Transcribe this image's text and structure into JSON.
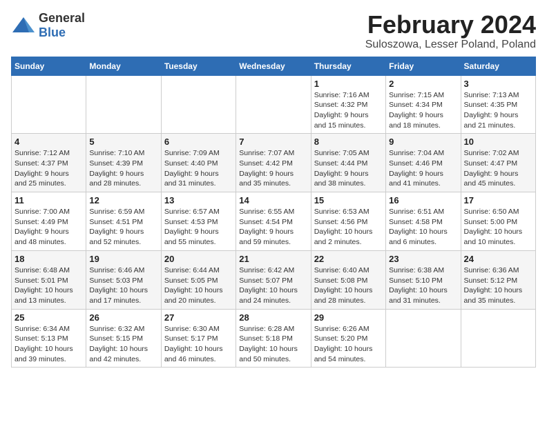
{
  "header": {
    "logo_general": "General",
    "logo_blue": "Blue",
    "month_title": "February 2024",
    "location": "Suloszowa, Lesser Poland, Poland"
  },
  "weekdays": [
    "Sunday",
    "Monday",
    "Tuesday",
    "Wednesday",
    "Thursday",
    "Friday",
    "Saturday"
  ],
  "weeks": [
    [
      {
        "day": "",
        "info": ""
      },
      {
        "day": "",
        "info": ""
      },
      {
        "day": "",
        "info": ""
      },
      {
        "day": "",
        "info": ""
      },
      {
        "day": "1",
        "info": "Sunrise: 7:16 AM\nSunset: 4:32 PM\nDaylight: 9 hours\nand 15 minutes."
      },
      {
        "day": "2",
        "info": "Sunrise: 7:15 AM\nSunset: 4:34 PM\nDaylight: 9 hours\nand 18 minutes."
      },
      {
        "day": "3",
        "info": "Sunrise: 7:13 AM\nSunset: 4:35 PM\nDaylight: 9 hours\nand 21 minutes."
      }
    ],
    [
      {
        "day": "4",
        "info": "Sunrise: 7:12 AM\nSunset: 4:37 PM\nDaylight: 9 hours\nand 25 minutes."
      },
      {
        "day": "5",
        "info": "Sunrise: 7:10 AM\nSunset: 4:39 PM\nDaylight: 9 hours\nand 28 minutes."
      },
      {
        "day": "6",
        "info": "Sunrise: 7:09 AM\nSunset: 4:40 PM\nDaylight: 9 hours\nand 31 minutes."
      },
      {
        "day": "7",
        "info": "Sunrise: 7:07 AM\nSunset: 4:42 PM\nDaylight: 9 hours\nand 35 minutes."
      },
      {
        "day": "8",
        "info": "Sunrise: 7:05 AM\nSunset: 4:44 PM\nDaylight: 9 hours\nand 38 minutes."
      },
      {
        "day": "9",
        "info": "Sunrise: 7:04 AM\nSunset: 4:46 PM\nDaylight: 9 hours\nand 41 minutes."
      },
      {
        "day": "10",
        "info": "Sunrise: 7:02 AM\nSunset: 4:47 PM\nDaylight: 9 hours\nand 45 minutes."
      }
    ],
    [
      {
        "day": "11",
        "info": "Sunrise: 7:00 AM\nSunset: 4:49 PM\nDaylight: 9 hours\nand 48 minutes."
      },
      {
        "day": "12",
        "info": "Sunrise: 6:59 AM\nSunset: 4:51 PM\nDaylight: 9 hours\nand 52 minutes."
      },
      {
        "day": "13",
        "info": "Sunrise: 6:57 AM\nSunset: 4:53 PM\nDaylight: 9 hours\nand 55 minutes."
      },
      {
        "day": "14",
        "info": "Sunrise: 6:55 AM\nSunset: 4:54 PM\nDaylight: 9 hours\nand 59 minutes."
      },
      {
        "day": "15",
        "info": "Sunrise: 6:53 AM\nSunset: 4:56 PM\nDaylight: 10 hours\nand 2 minutes."
      },
      {
        "day": "16",
        "info": "Sunrise: 6:51 AM\nSunset: 4:58 PM\nDaylight: 10 hours\nand 6 minutes."
      },
      {
        "day": "17",
        "info": "Sunrise: 6:50 AM\nSunset: 5:00 PM\nDaylight: 10 hours\nand 10 minutes."
      }
    ],
    [
      {
        "day": "18",
        "info": "Sunrise: 6:48 AM\nSunset: 5:01 PM\nDaylight: 10 hours\nand 13 minutes."
      },
      {
        "day": "19",
        "info": "Sunrise: 6:46 AM\nSunset: 5:03 PM\nDaylight: 10 hours\nand 17 minutes."
      },
      {
        "day": "20",
        "info": "Sunrise: 6:44 AM\nSunset: 5:05 PM\nDaylight: 10 hours\nand 20 minutes."
      },
      {
        "day": "21",
        "info": "Sunrise: 6:42 AM\nSunset: 5:07 PM\nDaylight: 10 hours\nand 24 minutes."
      },
      {
        "day": "22",
        "info": "Sunrise: 6:40 AM\nSunset: 5:08 PM\nDaylight: 10 hours\nand 28 minutes."
      },
      {
        "day": "23",
        "info": "Sunrise: 6:38 AM\nSunset: 5:10 PM\nDaylight: 10 hours\nand 31 minutes."
      },
      {
        "day": "24",
        "info": "Sunrise: 6:36 AM\nSunset: 5:12 PM\nDaylight: 10 hours\nand 35 minutes."
      }
    ],
    [
      {
        "day": "25",
        "info": "Sunrise: 6:34 AM\nSunset: 5:13 PM\nDaylight: 10 hours\nand 39 minutes."
      },
      {
        "day": "26",
        "info": "Sunrise: 6:32 AM\nSunset: 5:15 PM\nDaylight: 10 hours\nand 42 minutes."
      },
      {
        "day": "27",
        "info": "Sunrise: 6:30 AM\nSunset: 5:17 PM\nDaylight: 10 hours\nand 46 minutes."
      },
      {
        "day": "28",
        "info": "Sunrise: 6:28 AM\nSunset: 5:18 PM\nDaylight: 10 hours\nand 50 minutes."
      },
      {
        "day": "29",
        "info": "Sunrise: 6:26 AM\nSunset: 5:20 PM\nDaylight: 10 hours\nand 54 minutes."
      },
      {
        "day": "",
        "info": ""
      },
      {
        "day": "",
        "info": ""
      }
    ]
  ]
}
